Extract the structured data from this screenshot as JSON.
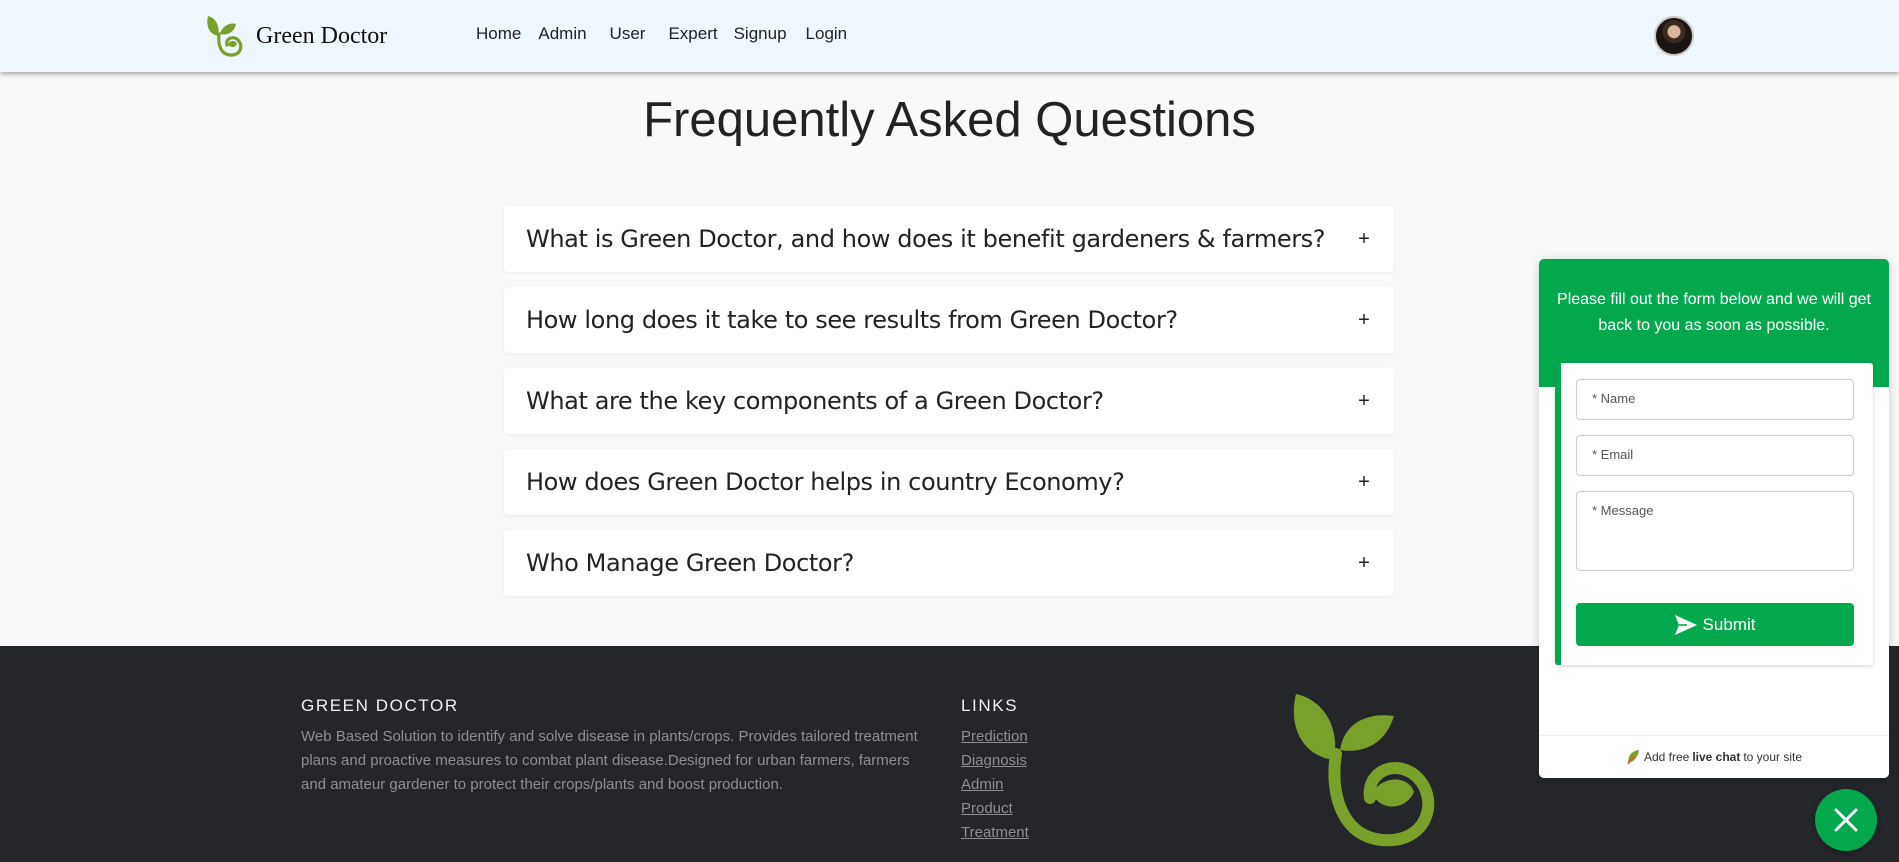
{
  "colors": {
    "accent_green": "#03a84e",
    "logo_green": "#7aa02c",
    "navbar_bg": "#eef6fe",
    "footer_bg": "#25262a"
  },
  "navbar": {
    "brand": "Green Doctor",
    "links": [
      "Home",
      "Admin",
      "User",
      "Expert",
      "Signup",
      "Login"
    ]
  },
  "faq": {
    "title": "Frequently Asked Questions",
    "toggle_symbol": "+",
    "items": [
      "What is Green Doctor, and how does it benefit gardeners & farmers?",
      "How long does it take to see results from Green Doctor?",
      "What are the key components of a Green Doctor?",
      "How does Green Doctor helps in country Economy?",
      "Who Manage Green Doctor?"
    ]
  },
  "footer": {
    "title": "GREEN DOCTOR",
    "description": "Web Based Solution to identify and solve disease in plants/crops. Provides tailored treatment plans and proactive measures to combat plant disease.Designed for urban farmers, farmers and amateur gardener to protect their crops/plants and boost production.",
    "links_title": "LINKS",
    "links": [
      "Prediction",
      "Diagnosis",
      "Admin",
      "Product",
      "Treatment"
    ]
  },
  "chat_widget": {
    "header_text": "Please fill out the form below and we will get back to you as soon as possible.",
    "name_placeholder": "* Name",
    "email_placeholder": "* Email",
    "message_placeholder": "* Message",
    "submit_label": "Submit",
    "footer_prefix": "Add free",
    "footer_bold": "live chat",
    "footer_suffix": "to your site"
  }
}
